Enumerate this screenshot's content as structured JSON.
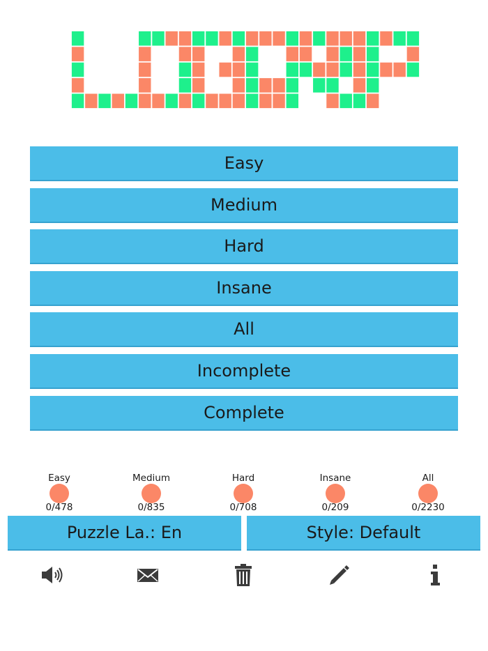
{
  "logo": {
    "text": "LOGRIP",
    "colors": {
      "green": "#1ef08c",
      "salmon": "#fb8767"
    },
    "grid": [
      "G....GGSSGGSGSSSGSGSSSGSGG",
      "S....S..SS..SG..SS.SGSG..S",
      "G....S..GS.SSG..GGSSGSGSSG",
      "S....S..GS..SGSSG.GG.SG...",
      "GSGSGSSGSGSSSGSSG..SGGS..."
    ]
  },
  "menu": {
    "items": [
      {
        "label": "Easy"
      },
      {
        "label": "Medium"
      },
      {
        "label": "Hard"
      },
      {
        "label": "Insane"
      },
      {
        "label": "All"
      },
      {
        "label": "Incomplete"
      },
      {
        "label": "Complete"
      }
    ]
  },
  "stats": [
    {
      "label": "Easy",
      "count": "0/478"
    },
    {
      "label": "Medium",
      "count": "0/835"
    },
    {
      "label": "Hard",
      "count": "0/708"
    },
    {
      "label": "Insane",
      "count": "0/209"
    },
    {
      "label": "All",
      "count": "0/2230"
    }
  ],
  "stat_dot_color": "#fb8767",
  "settings": {
    "puzzle_language": "Puzzle La.: En",
    "style": "Style: Default"
  },
  "toolbar": {
    "icons": [
      "speaker-icon",
      "mail-icon",
      "trash-icon",
      "pencil-icon",
      "info-icon"
    ]
  }
}
